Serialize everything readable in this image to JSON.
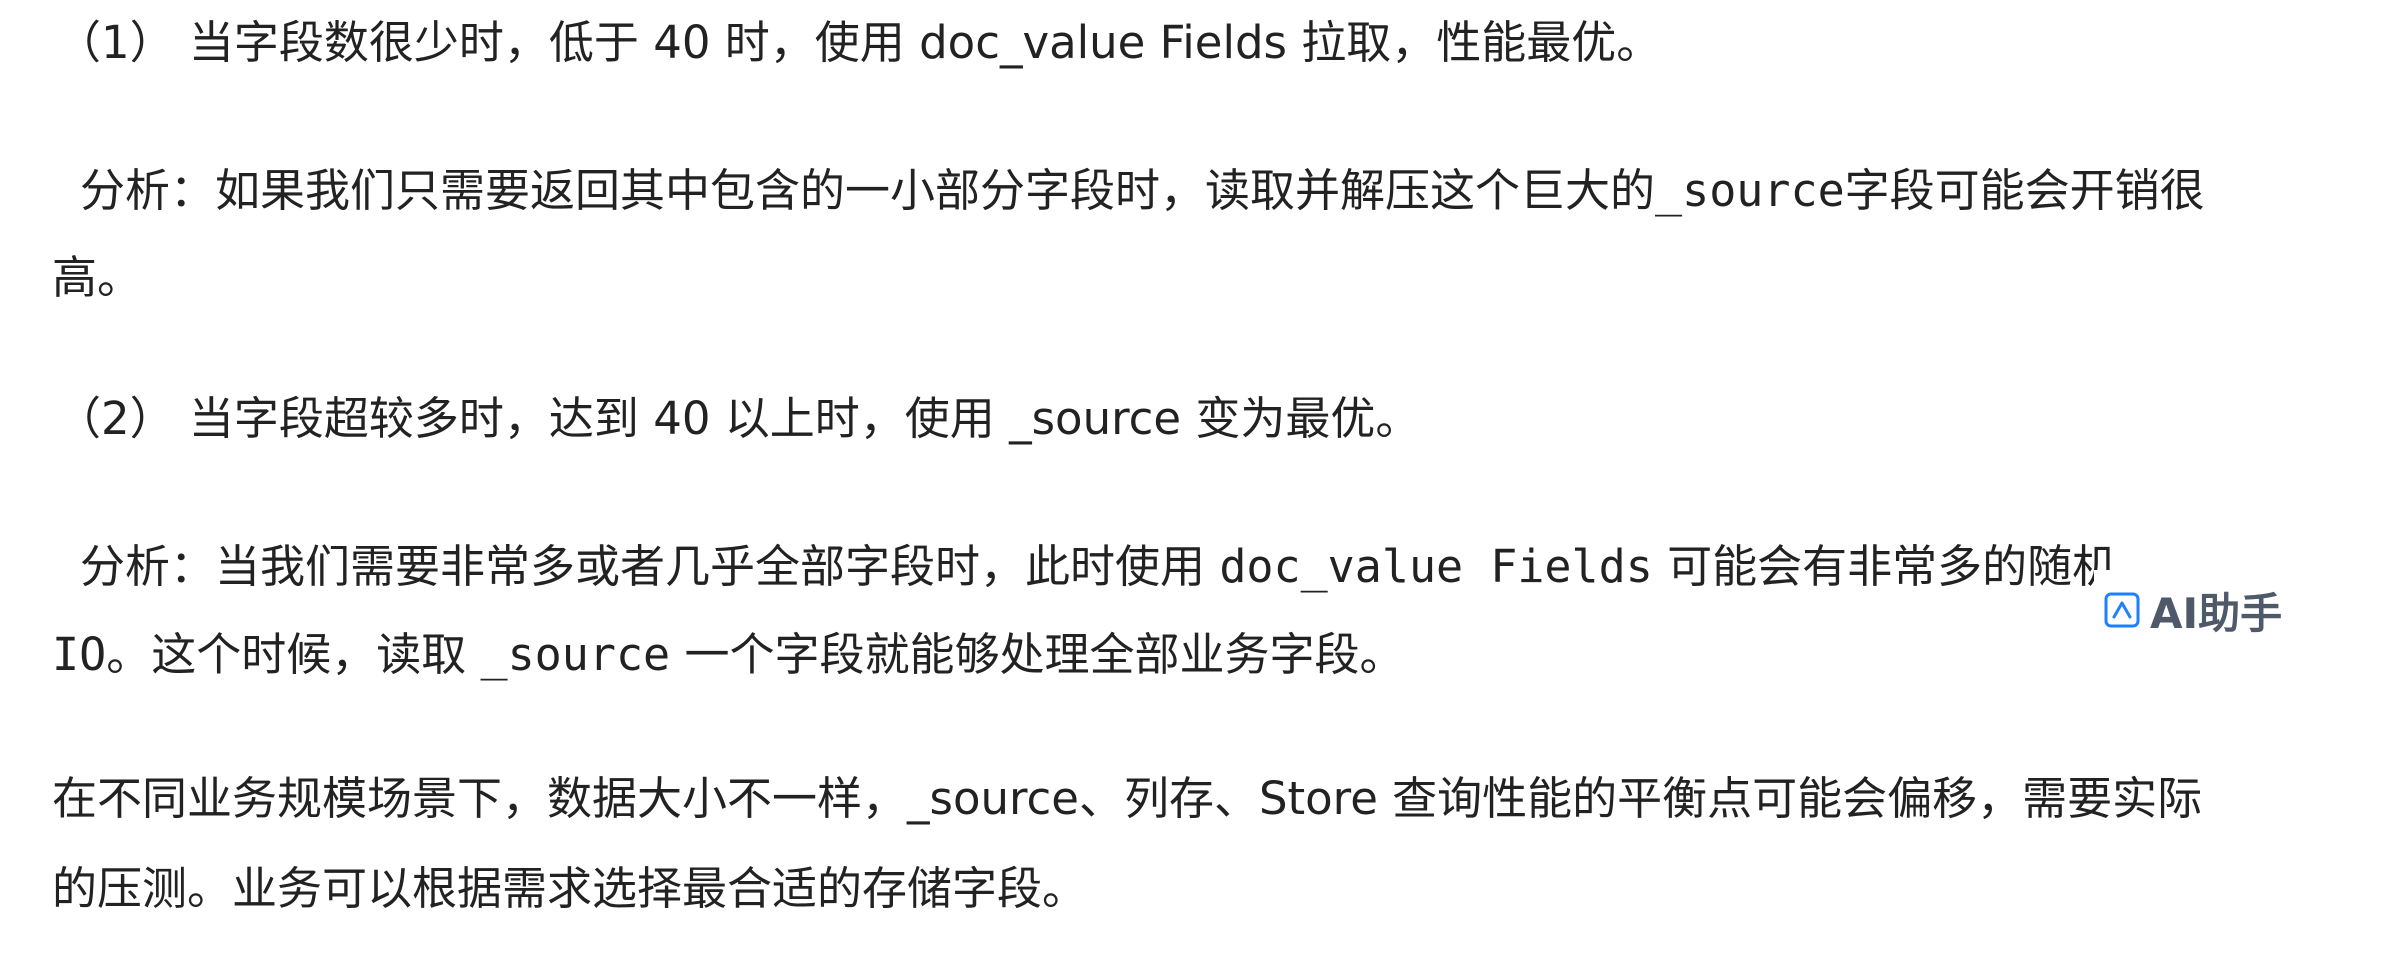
{
  "paragraphs": {
    "p1": "（1） 当字段数很少时，低于 40 时，使用 doc_value Fields 拉取，性能最优。",
    "p2_line1_text": "分析：如果我们只需要返回其中包含的一小部分字段时，读取并解压这个巨大的",
    "p2_line1_code": "_source",
    "p2_line1_tail": "字段可能会开销很",
    "p2_line2": "高。",
    "p3": "（2） 当字段超较多时，达到 40 以上时，使用 _source 变为最优。",
    "p4_line1_text": "分析：当我们需要非常多或者几乎全部字段时，此时使用 ",
    "p4_line1_code": "doc_value Fields",
    "p4_line1_tail": " 可能会有非常多的随机",
    "p4_line2_code1": "IO",
    "p4_line2_text": "。这个时候，读取 ",
    "p4_line2_code2": "_source",
    "p4_line2_tail": " 一个字段就能够处理全部业务字段。",
    "p5_line1": "在不同业务规模场景下，数据大小不一样，_source、列存、Store 查询性能的平衡点可能会偏移，需要实际",
    "p5_line2": "的压测。业务可以根据需求选择最合适的存储字段。"
  },
  "ai_assistant": {
    "label": "AI助手",
    "icon": "ai-assistant-icon",
    "color": "#4e5969"
  }
}
